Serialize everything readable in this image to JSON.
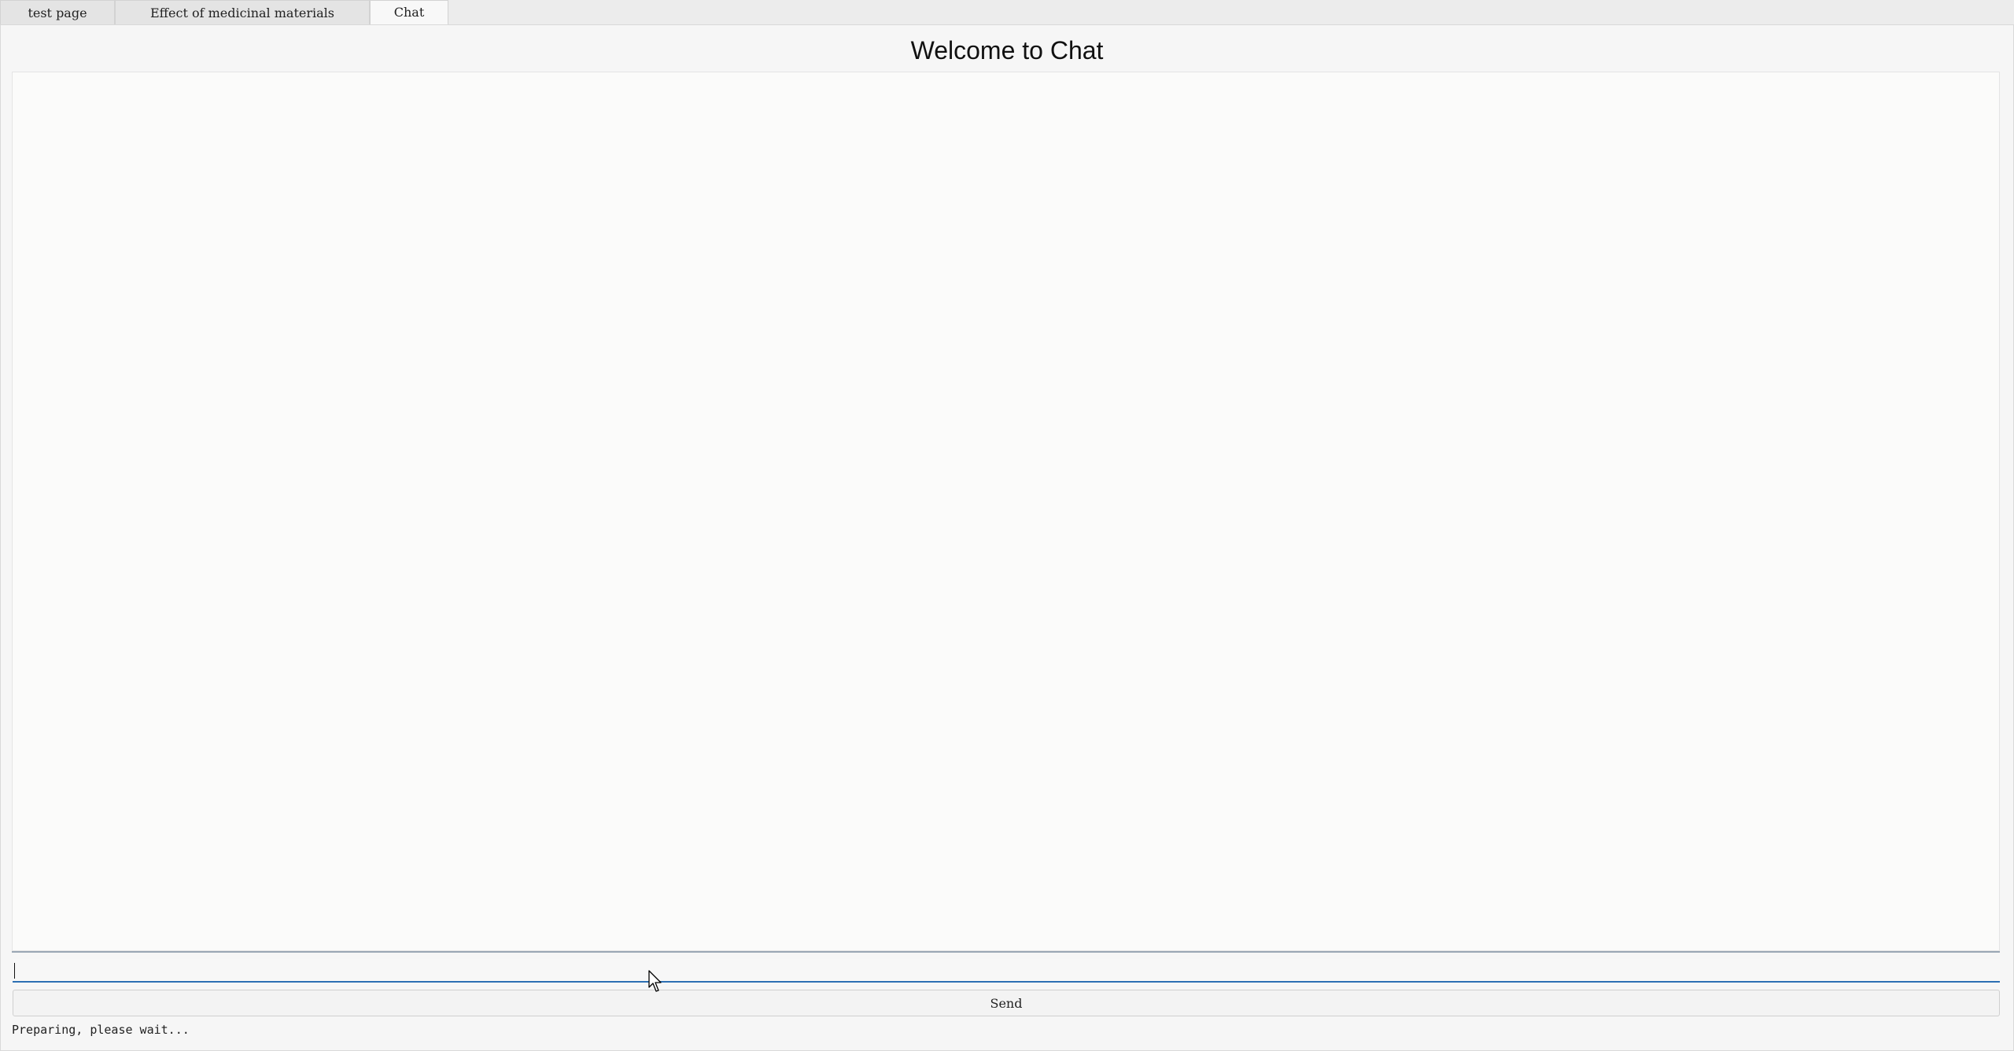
{
  "tabs": [
    {
      "label": "test page",
      "active": false
    },
    {
      "label": "Effect of medicinal materials",
      "active": false
    },
    {
      "label": "Chat",
      "active": true
    }
  ],
  "page": {
    "title": "Welcome to Chat"
  },
  "input": {
    "value": "",
    "placeholder": ""
  },
  "send_button": {
    "label": "Send"
  },
  "status": {
    "text": "Preparing, please wait..."
  },
  "colors": {
    "input_focus_underline": "#2c6fb3",
    "log_separator": "#9aa7b4"
  },
  "icons": {
    "cursor": "mouse-pointer-icon"
  }
}
